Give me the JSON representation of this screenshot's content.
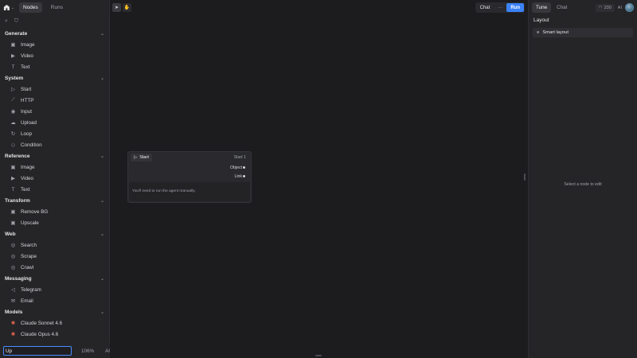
{
  "sidebar": {
    "tabs": [
      {
        "label": "Nodes",
        "active": true
      },
      {
        "label": "Runs",
        "active": false
      }
    ],
    "sections": [
      {
        "title": "Generate",
        "items": [
          {
            "label": "Image",
            "icon": "image-icon"
          },
          {
            "label": "Video",
            "icon": "video-icon"
          },
          {
            "label": "Text",
            "icon": "text-icon"
          }
        ]
      },
      {
        "title": "System",
        "items": [
          {
            "label": "Start",
            "icon": "play-icon"
          },
          {
            "label": "HTTP",
            "icon": "link-icon"
          },
          {
            "label": "Input",
            "icon": "input-icon"
          },
          {
            "label": "Upload",
            "icon": "cloud-upload-icon"
          },
          {
            "label": "Loop",
            "icon": "loop-icon"
          },
          {
            "label": "Condition",
            "icon": "diamond-icon"
          }
        ]
      },
      {
        "title": "Reference",
        "items": [
          {
            "label": "Image",
            "icon": "image-icon"
          },
          {
            "label": "Video",
            "icon": "video-icon"
          },
          {
            "label": "Text",
            "icon": "text-icon"
          }
        ]
      },
      {
        "title": "Transform",
        "items": [
          {
            "label": "Remove BG",
            "icon": "image-icon"
          },
          {
            "label": "Upscale",
            "icon": "image-icon"
          }
        ]
      },
      {
        "title": "Web",
        "items": [
          {
            "label": "Search",
            "icon": "globe-icon"
          },
          {
            "label": "Scrape",
            "icon": "globe-icon"
          },
          {
            "label": "Crawl",
            "icon": "globe-icon"
          }
        ]
      },
      {
        "title": "Messaging",
        "items": [
          {
            "label": "Telegram",
            "icon": "send-icon"
          },
          {
            "label": "Email",
            "icon": "mail-icon"
          }
        ]
      },
      {
        "title": "Models",
        "items": [
          {
            "label": "Claude Sonnet 4.6",
            "icon": "claude-icon"
          },
          {
            "label": "Claude Opus 4.6",
            "icon": "claude-icon"
          }
        ]
      }
    ],
    "search_value": "Up",
    "zoom": "106%",
    "ai_label": "AI"
  },
  "canvas": {
    "actions": {
      "chat": "Chat",
      "more": "···",
      "run": "Run"
    },
    "node": {
      "title": "Start",
      "id": "Start 1",
      "outputs": [
        "Object",
        "Link"
      ],
      "note": "You'll need to run the agent manually."
    }
  },
  "rpanel": {
    "tabs": [
      {
        "label": "Tune",
        "active": true
      },
      {
        "label": "Chat",
        "active": false
      }
    ],
    "credits": "230",
    "ai_label": "AI",
    "layout_label": "Layout",
    "smart_layout": "Smart layout",
    "empty_message": "Select a node to edit"
  },
  "colors": {
    "accent": "#3b82f6",
    "search_border": "#4a8cff",
    "claude": "#e8644f"
  }
}
